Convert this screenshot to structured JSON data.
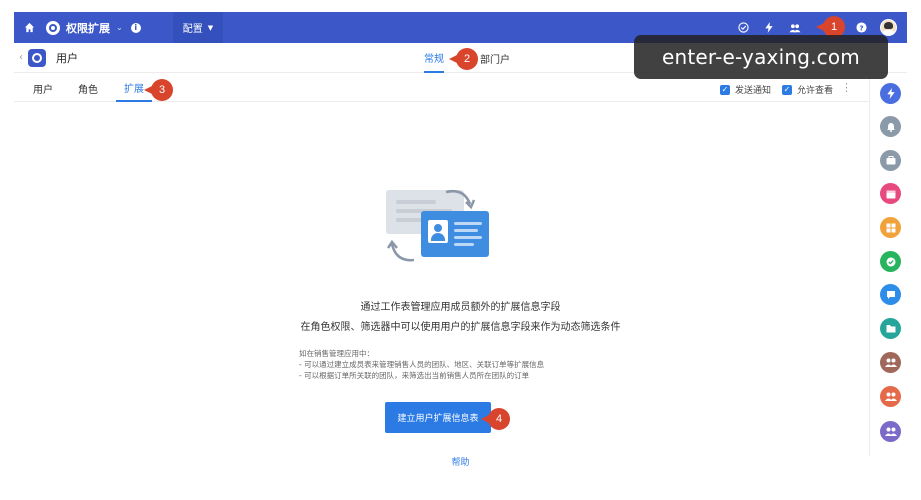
{
  "topbar": {
    "app_name": "权限扩展",
    "config_tab": "配置"
  },
  "subheader": {
    "title": "用户",
    "tab_general": "常规",
    "tab_department": "部门户"
  },
  "tabs": {
    "users": "用户",
    "roles": "角色",
    "extension": "扩展"
  },
  "options": {
    "send_notice": "发送通知",
    "allow_view": "允许查看"
  },
  "watermark": "enter-e-yaxing.com",
  "badges": [
    "1",
    "2",
    "3",
    "4"
  ],
  "content": {
    "description_line1": "通过工作表管理应用成员额外的扩展信息字段",
    "description_line2": "在角色权限、筛选器中可以使用用户的扩展信息字段来作为动态筛选条件",
    "notes": [
      "如在销售管理应用中：",
      "- 可以通过建立成员表来管理销售人员的团队、地区、关联订单等扩展信息",
      "- 可以根据订单所关联的团队，来筛选出当前销售人员所在团队的订单"
    ],
    "create_button": "建立用户扩展信息表",
    "help_link": "帮助"
  },
  "colors": {
    "topbar": "#3c58c8",
    "accent": "#2c7be5",
    "badge": "#d8442c"
  },
  "rail_icons": [
    {
      "name": "lightning-icon",
      "color": "#4a6ee0"
    },
    {
      "name": "bell-icon",
      "color": "#8a9aa8"
    },
    {
      "name": "briefcase-icon",
      "color": "#8a9aa8"
    },
    {
      "name": "calendar-icon",
      "color": "#e64a7e"
    },
    {
      "name": "grid-icon",
      "color": "#f2a23a"
    },
    {
      "name": "check-icon",
      "color": "#26b55e"
    },
    {
      "name": "chat-icon",
      "color": "#2d8de8"
    },
    {
      "name": "folder-icon",
      "color": "#26a69a"
    },
    {
      "name": "group-icon",
      "color": "#a0685a"
    },
    {
      "name": "group-icon",
      "color": "#e56a4a"
    },
    {
      "name": "group-icon",
      "color": "#7b6ac8"
    }
  ]
}
